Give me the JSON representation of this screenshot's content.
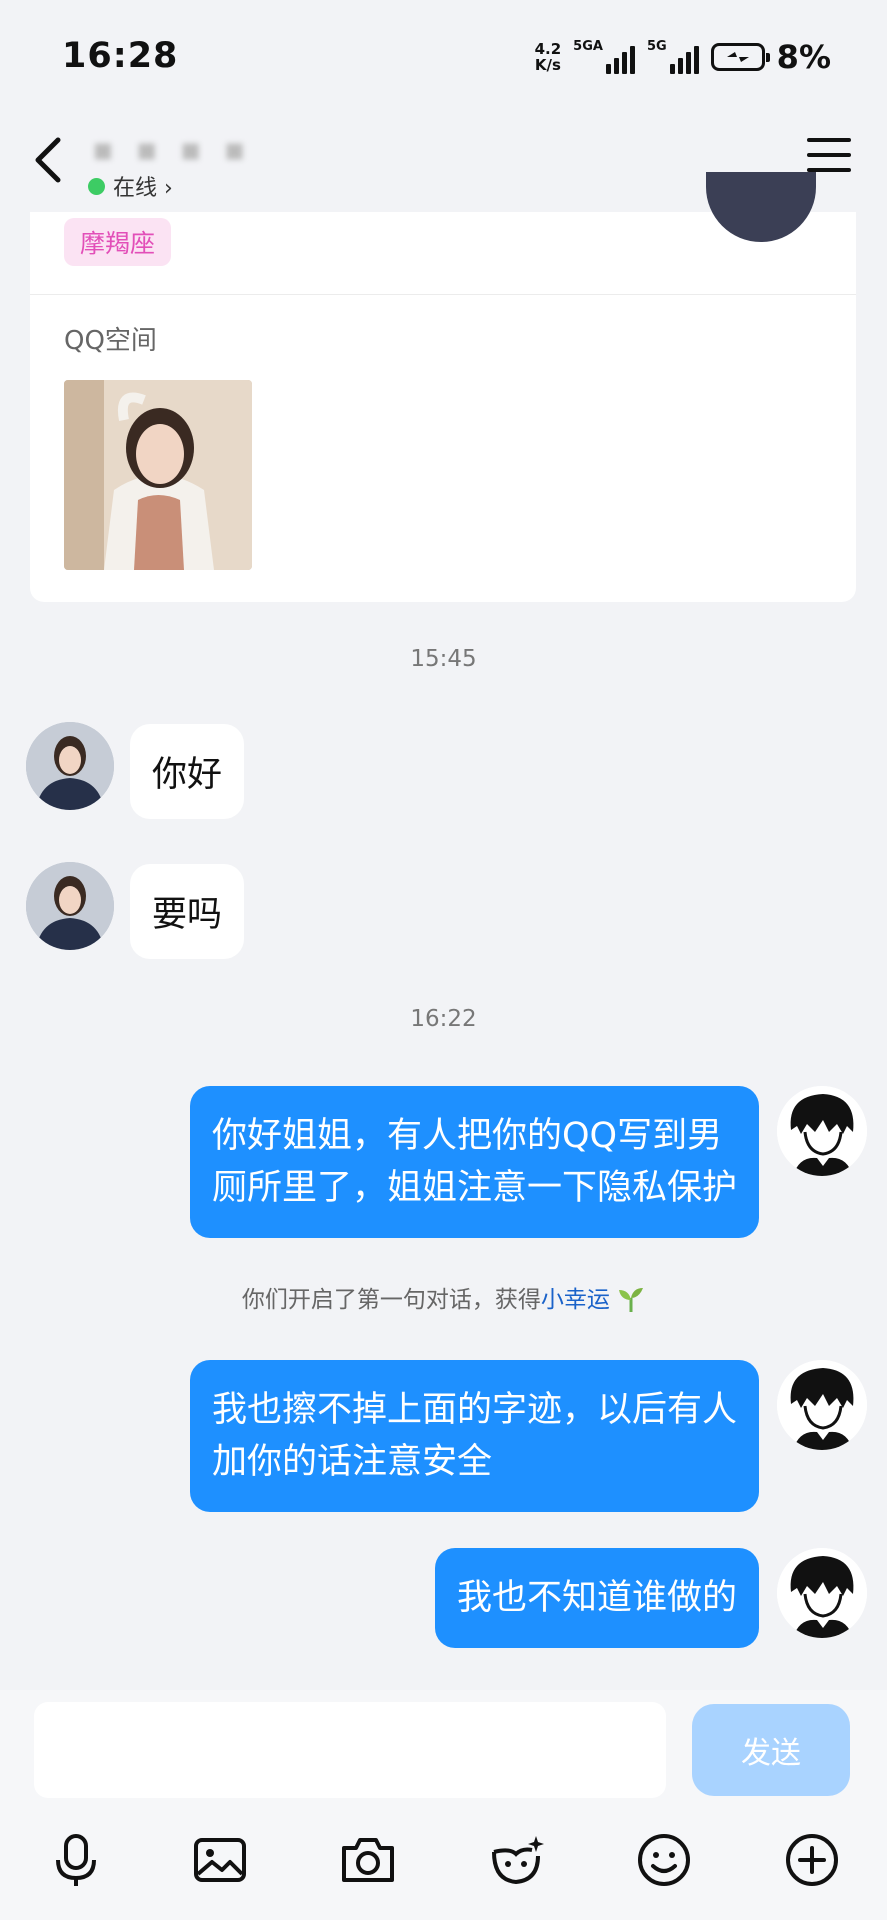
{
  "status_bar": {
    "time": "16:28",
    "net_speed_value": "4.2",
    "net_speed_unit": "K/s",
    "signal1_label": "5GA",
    "signal2_label": "5G",
    "battery_percent": "8%"
  },
  "header": {
    "contact_name": "▪ ▪ ▪ ▪",
    "online_status": "在线 ›"
  },
  "profile_card": {
    "zodiac": "摩羯座",
    "qzone_title": "QQ空间"
  },
  "timestamps": [
    "15:45",
    "16:22"
  ],
  "messages": [
    {
      "direction": "in",
      "text": "你好"
    },
    {
      "direction": "in",
      "text": "要吗"
    },
    {
      "direction": "out",
      "line1": "你好姐姐，有人把你的QQ写到男",
      "line2": "厕所里了，姐姐注意一下隐私保护"
    },
    {
      "direction": "out",
      "line1": "我也擦不掉上面的字迹，以后有人",
      "line2": "加你的话注意安全"
    },
    {
      "direction": "out",
      "text": "我也不知道谁做的"
    }
  ],
  "system_note": {
    "prefix": "你们开启了第一句对话，获得",
    "link": "小幸运",
    "icon": "sprout-icon"
  },
  "input": {
    "value": "",
    "send_label": "发送"
  },
  "toolbar_icons": [
    "microphone-icon",
    "picture-icon",
    "camera-icon",
    "sticker-icon",
    "emoji-icon",
    "plus-icon"
  ],
  "colors": {
    "outgoing_bubble": "#1e90ff",
    "send_button_disabled": "#a9d3ff",
    "online_dot": "#3dcc64",
    "zodiac_tag_text": "#e24fb8",
    "lucky_link": "#1a62c9"
  }
}
